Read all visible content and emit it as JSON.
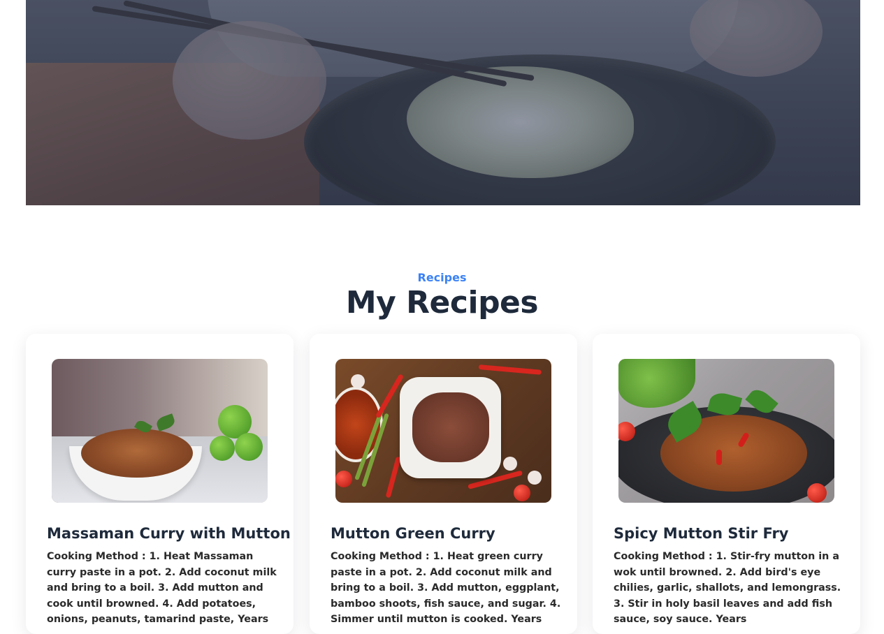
{
  "section": {
    "eyebrow": "Recipes",
    "title": "My Recipes"
  },
  "recipes": [
    {
      "title": "Massaman Curry with Mutton",
      "description": "Cooking Method : 1. Heat Massaman curry paste in a pot. 2. Add coconut milk and bring to a boil. 3. Add mutton and cook until browned. 4. Add potatoes, onions, peanuts, tamarind paste, Years"
    },
    {
      "title": "Mutton Green Curry",
      "description": "Cooking Method : 1. Heat green curry paste in a pot. 2. Add coconut milk and bring to a boil. 3. Add mutton, eggplant, bamboo shoots, fish sauce, and sugar. 4. Simmer until mutton is cooked. Years"
    },
    {
      "title": "Spicy Mutton Stir Fry",
      "description": "Cooking Method : 1. Stir-fry mutton in a wok until browned. 2. Add bird's eye chilies, garlic, shallots, and lemongrass. 3. Stir in holy basil leaves and add fish sauce, soy sauce. Years"
    }
  ]
}
